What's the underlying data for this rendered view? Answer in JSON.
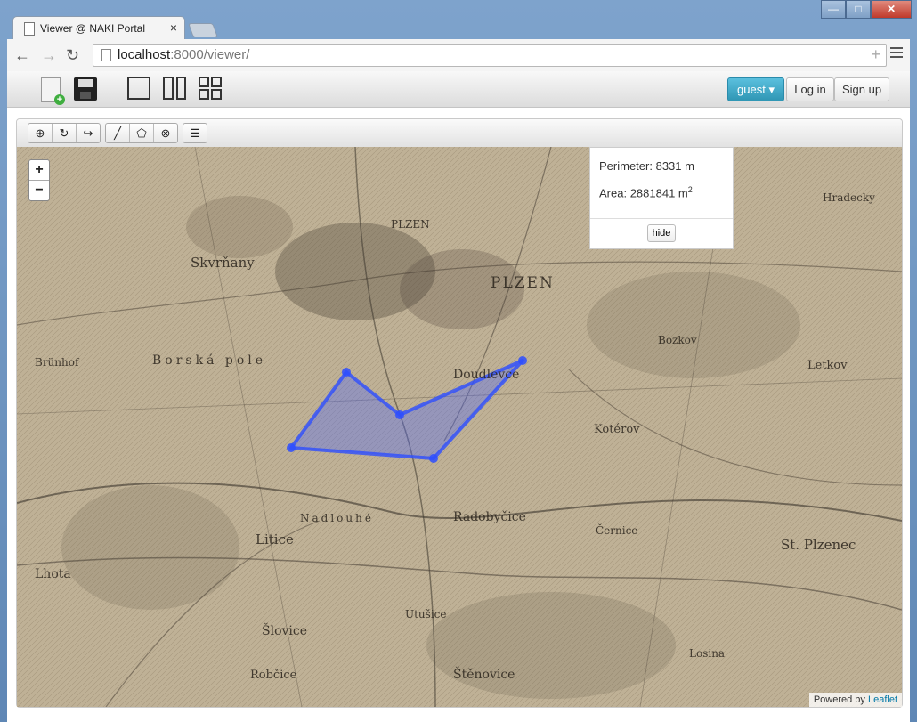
{
  "browser": {
    "tab_title": "Viewer @ NAKI Portal",
    "tab_close": "×",
    "url_host": "localhost",
    "url_rest": ":8000/viewer/",
    "controls": {
      "minimize": "—",
      "maximize": "□",
      "close": "✕"
    },
    "nav": {
      "back": "←",
      "forward": "→",
      "reload": "↻"
    },
    "add_bookmark": "+"
  },
  "appbar": {
    "user_label": "guest",
    "login_label": "Log in",
    "signup_label": "Sign up"
  },
  "map_toolbar": {
    "add_icon": "⊕",
    "refresh_icon": "↻",
    "rotate_icon": "↪",
    "line_icon": "╱",
    "polygon_icon": "⬠",
    "clear_icon": "⊗",
    "list_icon": "☰"
  },
  "map": {
    "zoom_in": "+",
    "zoom_out": "−",
    "measure": {
      "perimeter_label": "Perimeter:",
      "perimeter_value": "8331 m",
      "area_label": "Area:",
      "area_value": "2881841 m",
      "area_exp": "2",
      "hide_label": "hide"
    },
    "attribution_prefix": "Powered by",
    "attribution_link": "Leaflet",
    "places": [
      "Skvrňany",
      "PLZEN",
      "PLZEN",
      "Borská pole",
      "Doudlevce",
      "Kotérov",
      "Bozkov",
      "Letkov",
      "Nadlouhé",
      "Litice",
      "Radobyčice",
      "Černice",
      "St. Plzenec",
      "Robčice",
      "Šlovice",
      "Štěnovice",
      "Útušice",
      "Brünhof",
      "Lhota",
      "Hradecky",
      "Losina"
    ],
    "polygon_color": "#2d4dff"
  }
}
